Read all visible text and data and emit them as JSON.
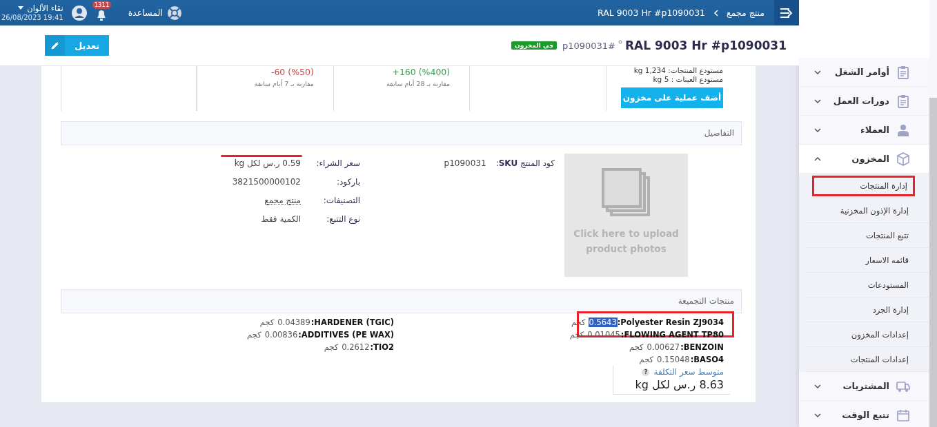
{
  "topbar": {
    "user": {
      "name": "نقاء الألوان",
      "datetime": "19:41 26/08/2023"
    },
    "notifications": {
      "count": "1311"
    },
    "help": {
      "label": "المساعدة"
    },
    "breadcrumb": [
      {
        "label": "منتج مجمع"
      },
      {
        "label": "RAL 9003 Hr #p1090031"
      }
    ]
  },
  "header": {
    "title": "RAL 9003 Hr #p1090031",
    "code": "p1090031#",
    "status": "في المخزون",
    "edit_button": "تعديل"
  },
  "stats": [
    {
      "kind": "stock",
      "lines": [
        "مستودع المنتجات: 1,234 kg",
        "مستودع العينات : 5 kg"
      ],
      "button": "أضف عملية على مخزون"
    },
    {
      "kind": "change",
      "color": "#3a9a55",
      "value": "+160 (%400)",
      "note": "مقارنة بـ 28 أيام سابقة"
    },
    {
      "kind": "change",
      "color": "#c9454b",
      "value": "-60 (%50)",
      "note": "مقارنة بـ 7 أيام سابقة"
    }
  ],
  "details": {
    "title": "التفاصيل",
    "photo_hint": "Click here to upload product photos",
    "sku": {
      "label": "كود المنتج **SKU**:",
      "value": "p1090031"
    },
    "fields": [
      {
        "label": "سعر الشراء:",
        "value": "0.59 ر.س لكل kg",
        "kind": "text",
        "struck": true
      },
      {
        "label": "باركود:",
        "value": "3821500000102",
        "kind": "text",
        "struck": false
      },
      {
        "label": "التصنيفات:",
        "value": "منتج مجمع",
        "kind": "link",
        "struck": false
      },
      {
        "label": "نوع التتبع:",
        "value": "الكمية فقط",
        "kind": "text",
        "struck": false
      }
    ]
  },
  "assembly": {
    "title": "منتجات التجميعة",
    "columns": [
      [
        {
          "name": "Polyester Resin ZJ9034:",
          "qty": "0.5643",
          "unit": "كجم",
          "highlighted": true,
          "outlined": true
        },
        {
          "name": "FLOWING AGENT TP80:",
          "qty": "0.01045",
          "unit": "كجم",
          "highlighted": false,
          "outlined": false
        },
        {
          "name": "BENZOIN:",
          "qty": "0.00627",
          "unit": "كجم",
          "highlighted": false,
          "outlined": false
        },
        {
          "name": "BASO4:",
          "qty": "0.15048",
          "unit": "كجم",
          "highlighted": false,
          "outlined": false
        }
      ],
      [
        {
          "name": "HARDENER (TGIC):",
          "qty": "0.04389",
          "unit": "كجم",
          "highlighted": false,
          "outlined": false
        },
        {
          "name": "ADDITIVES (PE WAX):",
          "qty": "0.00836",
          "unit": "كجم",
          "highlighted": false,
          "outlined": false
        },
        {
          "name": "TIO2:",
          "qty": "0.2612",
          "unit": "كجم",
          "highlighted": false,
          "outlined": false
        }
      ]
    ],
    "cost": {
      "label": "متوسط سعر التكلفة",
      "help": "?",
      "value": "8.63 ر.س لكل kg"
    }
  },
  "sidebar": {
    "items": [
      {
        "label": "أوامر الشغل",
        "kind": "clipboard",
        "expanded": false
      },
      {
        "label": "دورات العمل",
        "kind": "clipboard",
        "expanded": false
      },
      {
        "label": "العملاء",
        "kind": "person",
        "expanded": false
      },
      {
        "label": "المخزون",
        "kind": "box",
        "expanded": true,
        "children": [
          {
            "label": "إدارة المنتجات",
            "selected": true
          },
          {
            "label": "إدارة الإذون المخزنية",
            "selected": false
          },
          {
            "label": "تتبع المنتجات",
            "selected": false
          },
          {
            "label": "قائمه الاسعار",
            "selected": false
          },
          {
            "label": "المستودعات",
            "selected": false
          },
          {
            "label": "إدارة الجرد",
            "selected": false
          },
          {
            "label": "إعدادات المخزون",
            "selected": false
          },
          {
            "label": "إعدادات المنتجات",
            "selected": false
          }
        ]
      },
      {
        "label": "المشتريات",
        "kind": "truck",
        "expanded": false
      },
      {
        "label": "تتبع الوقت",
        "kind": "calendar",
        "expanded": false
      }
    ]
  }
}
